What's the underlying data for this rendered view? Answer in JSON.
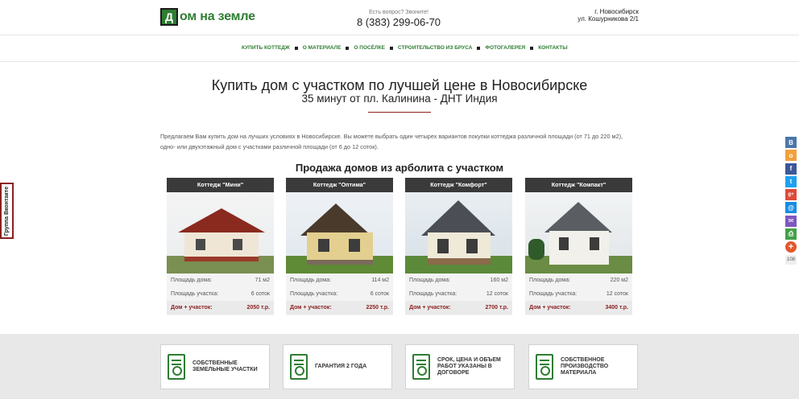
{
  "header": {
    "logo_letter": "Д",
    "logo_text": "ом на земле",
    "phone_question": "Есть вопрос? Звоните!",
    "phone": "8 (383) 299-06-70",
    "address_city": "г. Новосибирск",
    "address_street": "ул. Кошурникова 2/1"
  },
  "nav": {
    "items": [
      {
        "label": "КУПИТЬ КОТТЕДЖ"
      },
      {
        "label": "О МАТЕРИАЛЕ"
      },
      {
        "label": "О ПОСЁЛКЕ"
      },
      {
        "label": "СТРОИТЕЛЬСТВО ИЗ БРУСА"
      },
      {
        "label": "ФОТОГАЛЕРЕЯ"
      },
      {
        "label": "КОНТАКТЫ"
      }
    ]
  },
  "hero": {
    "title": "Купить дом с участком по лучшей цене в Новосибирске",
    "subtitle": "35 минут от пл. Калинина - ДНТ Индия"
  },
  "intro": "Предлагаем Вам купить дом на лучших условиях в Новосибирске. Вы можете выбрать один четырех вариантов покупки коттеджа различной площади (от 71 до 220 м2), одно- или двухэтажный дом с участками различной площади (от 6 до 12 соток).",
  "section_title": "Продажа домов из арболита с участком",
  "cards": [
    {
      "title": "Коттедж \"Мини\"",
      "area_label": "Площадь дома:",
      "area": "71 м2",
      "plot_label": "Площадь участка:",
      "plot": "6 соток",
      "price_label": "Дом + участок:",
      "price": "2050 т.р."
    },
    {
      "title": "Коттедж \"Оптима\"",
      "area_label": "Площадь дома:",
      "area": "114 м2",
      "plot_label": "Площадь участка:",
      "plot": "6 соток",
      "price_label": "Дом + участок:",
      "price": "2250 т.р."
    },
    {
      "title": "Коттедж \"Комфорт\"",
      "area_label": "Площадь дома:",
      "area": "160 м2",
      "plot_label": "Площадь участка:",
      "plot": "12 соток",
      "price_label": "Дом + участок:",
      "price": "2700 т.р."
    },
    {
      "title": "Коттедж \"Компакт\"",
      "area_label": "Площадь дома:",
      "area": "220 м2",
      "plot_label": "Площадь участка:",
      "plot": "12 соток",
      "price_label": "Дом + участок:",
      "price": "3400 т.р."
    }
  ],
  "features": [
    {
      "line1": "СОБСТВЕННЫЕ",
      "line2": "ЗЕМЕЛЬНЫЕ УЧАСТКИ",
      "line3": ""
    },
    {
      "line1": "ГАРАНТИЯ 2 ГОДА",
      "line2": "",
      "line3": ""
    },
    {
      "line1": "СРОК, ЦЕНА И ОБЪЕМ",
      "line2": "РАБОТ УКАЗАНЫ В",
      "line3": "ДОГОВОРЕ"
    },
    {
      "line1": "СОБСТВЕННОЕ",
      "line2": "ПРОИЗВОДСТВО",
      "line3": "МАТЕРИАЛА"
    }
  ],
  "vk_tab": "Группа Вконтакте",
  "share": {
    "buttons": [
      {
        "icon": "vk-icon",
        "glyph": "В",
        "color": "#4a76a8"
      },
      {
        "icon": "odnoklassniki-icon",
        "glyph": "о",
        "color": "#f2a03d"
      },
      {
        "icon": "facebook-icon",
        "glyph": "f",
        "color": "#3b5998"
      },
      {
        "icon": "twitter-icon",
        "glyph": "t",
        "color": "#1da1f2"
      },
      {
        "icon": "google-plus-icon",
        "glyph": "g+",
        "color": "#dd4b39"
      },
      {
        "icon": "mail-ru-icon",
        "glyph": "@",
        "color": "#168de2"
      },
      {
        "icon": "email-icon",
        "glyph": "✉",
        "color": "#7e57c2"
      },
      {
        "icon": "print-icon",
        "glyph": "⎙",
        "color": "#43a047"
      },
      {
        "icon": "more-icon",
        "glyph": "+",
        "color": "#e2572c"
      }
    ],
    "count": "108"
  }
}
